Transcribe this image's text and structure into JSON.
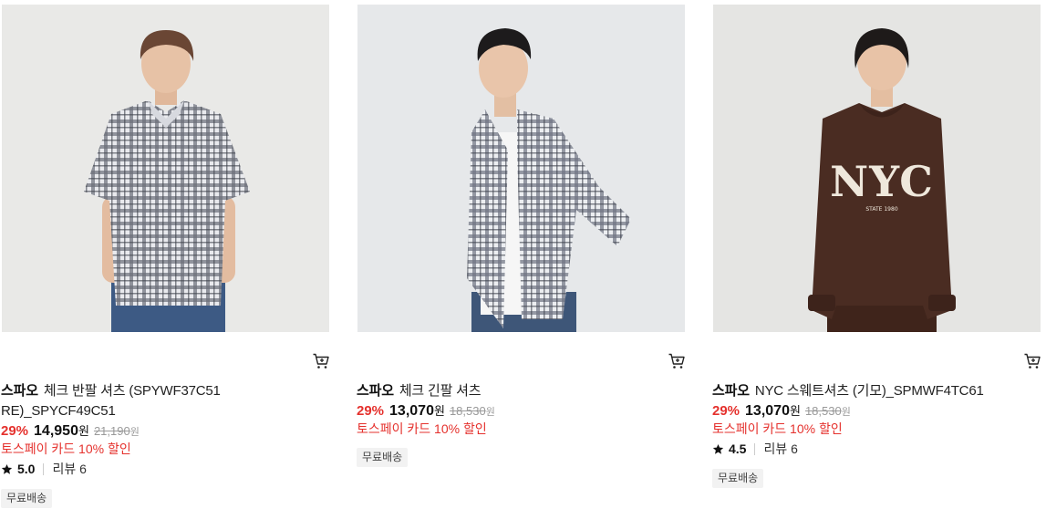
{
  "products": [
    {
      "brand": "스파오",
      "name": "체크 반팔 셔츠 (SPYWF37C51 RE)_SPYCF49C51",
      "discount": "29%",
      "price": "14,950",
      "price_unit": "원",
      "original_price": "21,190",
      "original_unit": "원",
      "promo": "토스페이 카드 10% 할인",
      "rating": "5.0",
      "reviews": "리뷰 6",
      "badge": "무료배송",
      "image": "model-short-sleeve-check-shirt",
      "cart_icon": "cart-icon"
    },
    {
      "brand": "스파오",
      "name": "체크 긴팔 셔츠",
      "discount": "29%",
      "price": "13,070",
      "price_unit": "원",
      "original_price": "18,530",
      "original_unit": "원",
      "promo": "토스페이 카드 10% 할인",
      "badge": "무료배송",
      "image": "model-long-sleeve-check-shirt",
      "cart_icon": "cart-icon"
    },
    {
      "brand": "스파오",
      "name": "NYC 스웨트셔츠 (기모)_SPMWF4TC61",
      "discount": "29%",
      "price": "13,070",
      "price_unit": "원",
      "original_price": "18,530",
      "original_unit": "원",
      "promo": "토스페이 카드 10% 할인",
      "rating": "4.5",
      "reviews": "리뷰 6",
      "badge": "무료배송",
      "image": "model-nyc-sweatshirt",
      "sweatshirt_text": "NYC",
      "sweatshirt_subtext": "STATE 1980",
      "cart_icon": "cart-icon"
    }
  ],
  "colors": {
    "discount": "#e5312d",
    "photo_bg_1": "#e9e9e7",
    "photo_bg_2": "#e6e8ea",
    "photo_bg_3": "#e5e5e3",
    "sweatshirt": "#4a2c22"
  }
}
